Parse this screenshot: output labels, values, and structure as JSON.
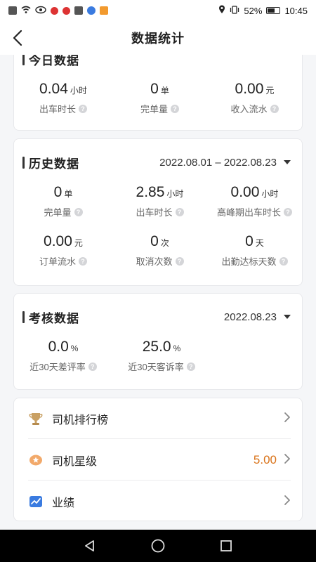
{
  "status_bar": {
    "battery": "52%",
    "time": "10:45"
  },
  "header": {
    "title": "数据统计"
  },
  "today": {
    "title": "今日数据",
    "stats": [
      {
        "value": "0.04",
        "unit": "小时",
        "label": "出车时长"
      },
      {
        "value": "0",
        "unit": "单",
        "label": "完单量"
      },
      {
        "value": "0.00",
        "unit": "元",
        "label": "收入流水"
      }
    ]
  },
  "history": {
    "title": "历史数据",
    "date_range": "2022.08.01 – 2022.08.23",
    "stats": [
      {
        "value": "0",
        "unit": "单",
        "label": "完单量"
      },
      {
        "value": "2.85",
        "unit": "小时",
        "label": "出车时长"
      },
      {
        "value": "0.00",
        "unit": "小时",
        "label": "高峰期出车时长"
      },
      {
        "value": "0.00",
        "unit": "元",
        "label": "订单流水"
      },
      {
        "value": "0",
        "unit": "次",
        "label": "取消次数"
      },
      {
        "value": "0",
        "unit": "天",
        "label": "出勤达标天数"
      }
    ]
  },
  "assessment": {
    "title": "考核数据",
    "date": "2022.08.23",
    "stats": [
      {
        "value": "0.0",
        "unit": "%",
        "label": "近30天差评率"
      },
      {
        "value": "25.0",
        "unit": "%",
        "label": "近30天客诉率"
      }
    ]
  },
  "menu": {
    "items": [
      {
        "label": "司机排行榜",
        "icon": "trophy-icon",
        "value": ""
      },
      {
        "label": "司机星级",
        "icon": "star-badge-icon",
        "value": "5.00"
      },
      {
        "label": "业绩",
        "icon": "chart-trend-icon",
        "value": ""
      }
    ]
  },
  "colors": {
    "accent_value": "#d9731a",
    "trophy": "#c9a063",
    "trend": "#3a7be0"
  },
  "help_glyph": "?"
}
